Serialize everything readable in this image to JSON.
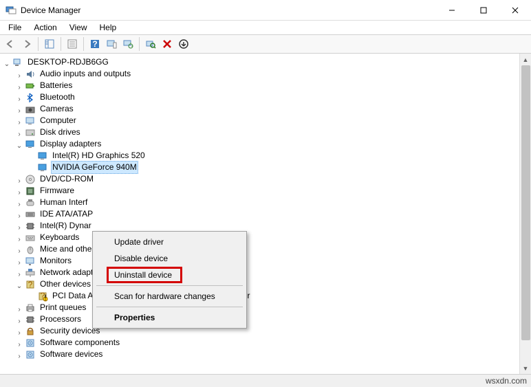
{
  "window": {
    "title": "Device Manager"
  },
  "menu": {
    "file": "File",
    "action": "Action",
    "view": "View",
    "help": "Help"
  },
  "toolbar": {
    "back": "back-icon",
    "forward": "forward-icon",
    "show_hide": "show-hide-tree-icon",
    "props_box": "properties-sheet-icon",
    "help": "help-icon",
    "pcinfo": "pc-info-icon",
    "monitor_refresh": "monitor-refresh-icon",
    "scan": "scan-hardware-icon",
    "delete": "delete-icon",
    "update": "add-legacy-icon"
  },
  "tree": {
    "root": "DESKTOP-RDJB6GG",
    "nodes": [
      {
        "icon": "audio",
        "label": "Audio inputs and outputs",
        "twisty": "closed"
      },
      {
        "icon": "battery",
        "label": "Batteries",
        "twisty": "closed"
      },
      {
        "icon": "bluetooth",
        "label": "Bluetooth",
        "twisty": "closed"
      },
      {
        "icon": "camera",
        "label": "Cameras",
        "twisty": "closed"
      },
      {
        "icon": "computer",
        "label": "Computer",
        "twisty": "closed"
      },
      {
        "icon": "disk",
        "label": "Disk drives",
        "twisty": "closed"
      },
      {
        "icon": "display",
        "label": "Display adapters",
        "twisty": "open",
        "children": [
          {
            "icon": "display",
            "label": "Intel(R) HD Graphics 520"
          },
          {
            "icon": "display",
            "label": "NVIDIA GeForce 940M",
            "selected": true
          }
        ]
      },
      {
        "icon": "dvd",
        "label": "DVD/CD-ROM",
        "twisty": "closed",
        "truncated": true
      },
      {
        "icon": "firmware",
        "label": "Firmware",
        "twisty": "closed"
      },
      {
        "icon": "hid",
        "label": "Human Interf",
        "twisty": "closed",
        "truncated": true
      },
      {
        "icon": "ide",
        "label": "IDE ATA/ATAP",
        "twisty": "closed",
        "truncated": true
      },
      {
        "icon": "cpu",
        "label": "Intel(R) Dynar",
        "twisty": "closed",
        "truncated": true
      },
      {
        "icon": "keyboard",
        "label": "Keyboards",
        "twisty": "closed"
      },
      {
        "icon": "mouse",
        "label": "Mice and othe",
        "twisty": "closed",
        "truncated": true
      },
      {
        "icon": "monitor",
        "label": "Monitors",
        "twisty": "closed"
      },
      {
        "icon": "network",
        "label": "Network adapters",
        "twisty": "closed"
      },
      {
        "icon": "other",
        "label": "Other devices",
        "twisty": "open",
        "children": [
          {
            "icon": "unknown",
            "label": "PCI Data Acquisition and Signal Processing Controller"
          }
        ]
      },
      {
        "icon": "printer",
        "label": "Print queues",
        "twisty": "closed"
      },
      {
        "icon": "cpu",
        "label": "Processors",
        "twisty": "closed"
      },
      {
        "icon": "security",
        "label": "Security devices",
        "twisty": "closed"
      },
      {
        "icon": "software",
        "label": "Software components",
        "twisty": "closed"
      },
      {
        "icon": "software",
        "label": "Software devices",
        "twisty": "closed",
        "cutoff": true
      }
    ]
  },
  "context_menu": {
    "update_driver": "Update driver",
    "disable_device": "Disable device",
    "uninstall_device": "Uninstall device",
    "scan_changes": "Scan for hardware changes",
    "properties": "Properties"
  },
  "footer": {
    "watermark": "wsxdn.com"
  }
}
